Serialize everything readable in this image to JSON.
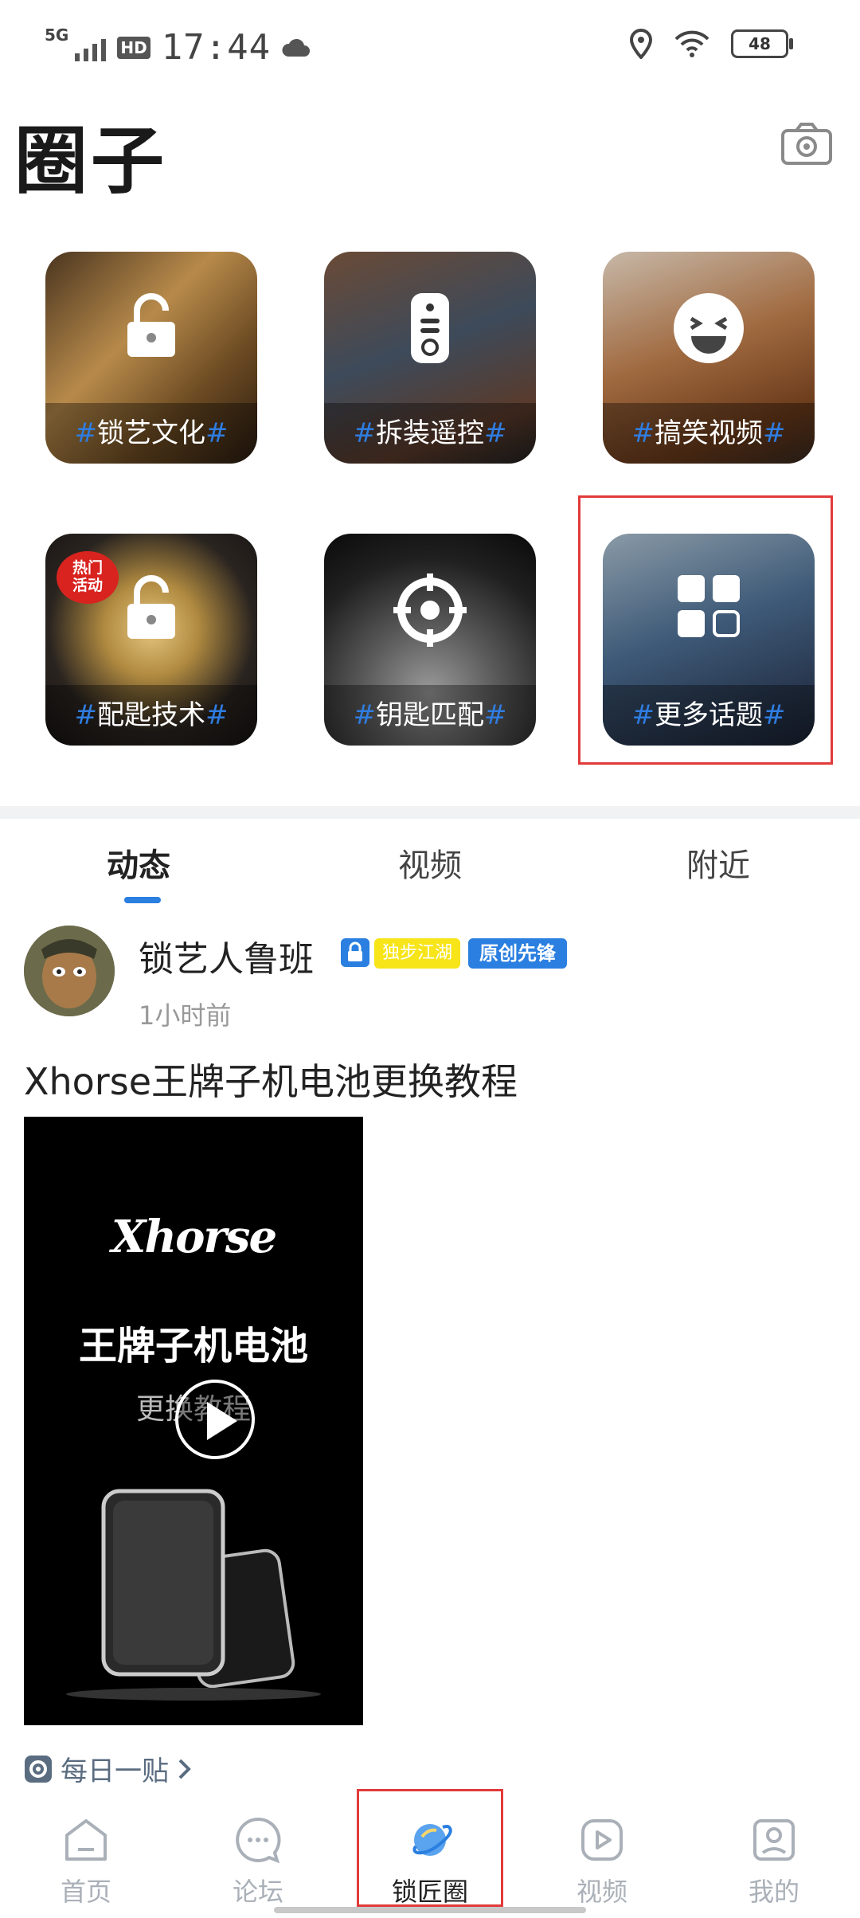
{
  "status_bar": {
    "network": "5G",
    "hd": "HD",
    "time": "17:44",
    "battery": "48"
  },
  "header": {
    "title": "圈子"
  },
  "topics": [
    {
      "name": "锁艺文化",
      "hash": "#"
    },
    {
      "name": "拆装遥控",
      "hash": "#"
    },
    {
      "name": "搞笑视频",
      "hash": "#"
    },
    {
      "name": "配匙技术",
      "hash": "#",
      "hot_badge": "热门活动"
    },
    {
      "name": "钥匙匹配",
      "hash": "#"
    },
    {
      "name": "更多话题",
      "hash": "#"
    }
  ],
  "tabs": [
    {
      "label": "动态"
    },
    {
      "label": "视频"
    },
    {
      "label": "附近"
    }
  ],
  "post": {
    "author": "锁艺人鲁班",
    "badge_yellow": "独步江湖",
    "badge_blue": "原创先锋",
    "time": "1小时前",
    "title": "Xhorse王牌子机电池更换教程",
    "video": {
      "brand": "Xhorse",
      "line1": "王牌子机电池",
      "line2": "更换教程"
    },
    "topic_link": "每日一贴"
  },
  "nav": [
    {
      "label": "首页"
    },
    {
      "label": "论坛"
    },
    {
      "label": "锁匠圈"
    },
    {
      "label": "视频"
    },
    {
      "label": "我的"
    }
  ],
  "colors": {
    "accent": "#2a7fe0",
    "highlight_box": "#e23a3a",
    "badge_yellow": "#f7e419"
  }
}
